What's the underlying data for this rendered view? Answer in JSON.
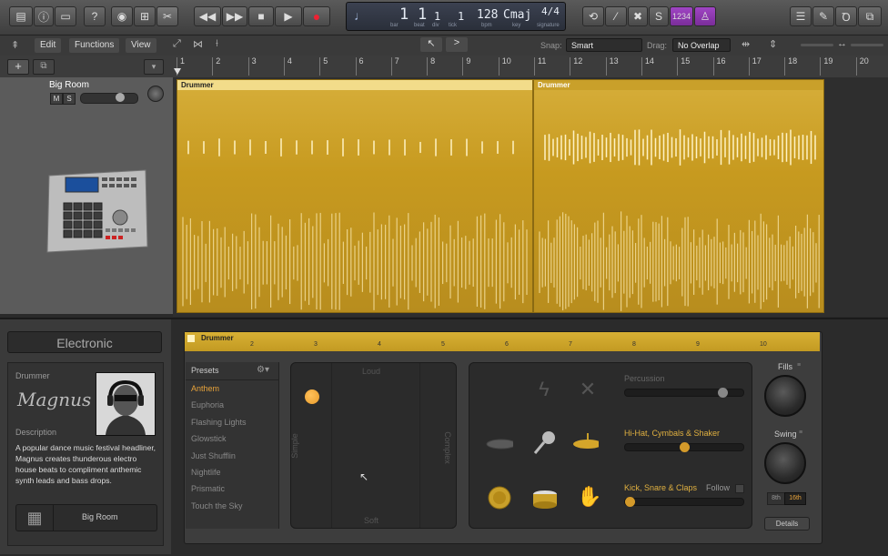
{
  "toolbar": {
    "lcd": {
      "bar": "1",
      "beat": "1",
      "div": "1",
      "tick": "1",
      "bpm": "128",
      "key": "Cmaj",
      "signature": "4/4",
      "labels": {
        "bar": "bar",
        "beat": "beat",
        "div": "div",
        "tick": "tick",
        "bpm": "bpm",
        "key": "key",
        "signature": "signature"
      }
    },
    "count_in": "1234"
  },
  "bar2": {
    "edit": "Edit",
    "functions": "Functions",
    "view": "View",
    "snap_label": "Snap:",
    "snap_value": "Smart",
    "drag_label": "Drag:",
    "drag_value": "No Overlap"
  },
  "ruler": {
    "bars": [
      "1",
      "2",
      "3",
      "4",
      "5",
      "6",
      "7",
      "8",
      "9",
      "10",
      "11",
      "12",
      "13",
      "14",
      "15",
      "16",
      "17",
      "18",
      "19",
      "20"
    ]
  },
  "track": {
    "name": "Big Room",
    "mute": "M",
    "solo": "S"
  },
  "regions": [
    {
      "name": "Drummer"
    },
    {
      "name": "Drummer"
    }
  ],
  "library": {
    "genre": "Electronic",
    "drummer_label": "Drummer",
    "signature": "Magnus",
    "description_label": "Description",
    "description": "A popular dance music festival headliner, Magnus creates thunderous electro house beats to compliment anthemic synth leads and bass drops.",
    "kit_name": "Big Room"
  },
  "editor": {
    "region_name": "Drummer",
    "ruler_bars": [
      "2",
      "3",
      "4",
      "5",
      "6",
      "7",
      "8",
      "9",
      "10"
    ],
    "presets_label": "Presets",
    "presets": [
      "Anthem",
      "Euphoria",
      "Flashing Lights",
      "Glowstick",
      "Just Shufflin",
      "Nightlife",
      "Prismatic",
      "Touch the Sky"
    ],
    "selected_preset": "Anthem",
    "xy": {
      "loud": "Loud",
      "soft": "Soft",
      "simple": "Simple",
      "complex": "Complex"
    },
    "percussion_label": "Percussion",
    "hihat_label": "Hi-Hat, Cymbals & Shaker",
    "kick_label": "Kick, Snare & Claps",
    "follow_label": "Follow",
    "percussion_level": 0.85,
    "hihat_level": 0.5,
    "kick_level": 0.0,
    "fills_label": "Fills",
    "swing_label": "Swing",
    "eighth": "8th",
    "sixteenth": "16th",
    "details": "Details"
  },
  "colors": {
    "accent": "#e8a33a",
    "region": "#c9a02a",
    "hihat_label": "#e0b040"
  }
}
